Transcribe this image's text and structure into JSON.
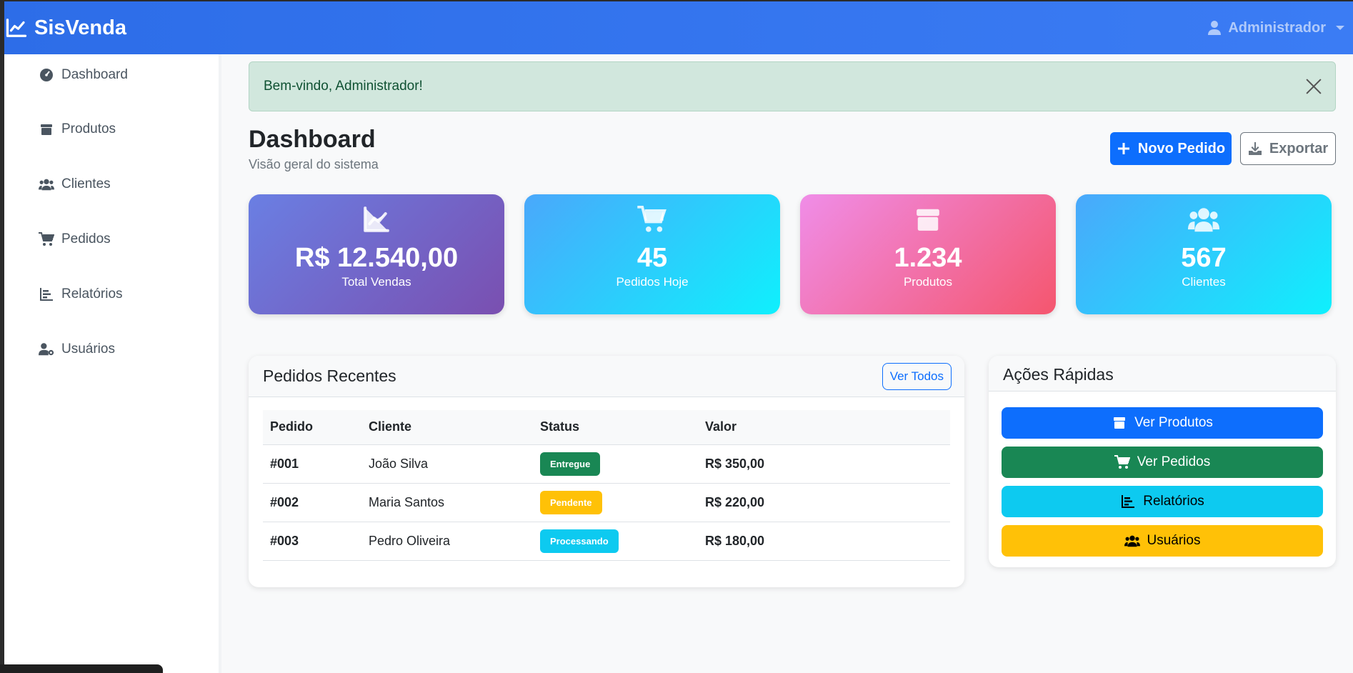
{
  "app": {
    "brand": "SisVenda",
    "user": "Administrador"
  },
  "sidebar": {
    "items": [
      {
        "label": "Dashboard",
        "icon": "gauge-icon"
      },
      {
        "label": "Produtos",
        "icon": "box-icon"
      },
      {
        "label": "Clientes",
        "icon": "users-icon"
      },
      {
        "label": "Pedidos",
        "icon": "cart-icon"
      },
      {
        "label": "Relatórios",
        "icon": "chart-icon"
      },
      {
        "label": "Usuários",
        "icon": "user-gear-icon"
      }
    ]
  },
  "alert": {
    "message": "Bem-vindo, Administrador!"
  },
  "header": {
    "title": "Dashboard",
    "subtitle": "Visão geral do sistema",
    "new_order": "Novo Pedido",
    "export": "Exportar"
  },
  "stats": [
    {
      "value": "R$ 12.540,00",
      "label": "Total Vendas",
      "icon": "chart-line-icon"
    },
    {
      "value": "45",
      "label": "Pedidos Hoje",
      "icon": "cart-icon"
    },
    {
      "value": "1.234",
      "label": "Produtos",
      "icon": "box-icon"
    },
    {
      "value": "567",
      "label": "Clientes",
      "icon": "users-icon"
    }
  ],
  "recent_orders": {
    "title": "Pedidos Recentes",
    "view_all": "Ver Todos",
    "columns": [
      "Pedido",
      "Cliente",
      "Status",
      "Valor"
    ],
    "rows": [
      {
        "id": "#001",
        "client": "João Silva",
        "status": "Entregue",
        "status_color": "#198754",
        "value": "R$ 350,00"
      },
      {
        "id": "#002",
        "client": "Maria Santos",
        "status": "Pendente",
        "status_color": "#ffc107",
        "value": "R$ 220,00"
      },
      {
        "id": "#003",
        "client": "Pedro Oliveira",
        "status": "Processando",
        "status_color": "#0dcaf0",
        "value": "R$ 180,00"
      }
    ]
  },
  "quick_actions": {
    "title": "Ações Rápidas",
    "buttons": [
      {
        "label": "Ver Produtos",
        "color": "#0d6efd"
      },
      {
        "label": "Ver Pedidos",
        "color": "#198754"
      },
      {
        "label": "Relatórios",
        "color": "#0dcaf0"
      },
      {
        "label": "Usuários",
        "color": "#ffc107"
      }
    ]
  }
}
